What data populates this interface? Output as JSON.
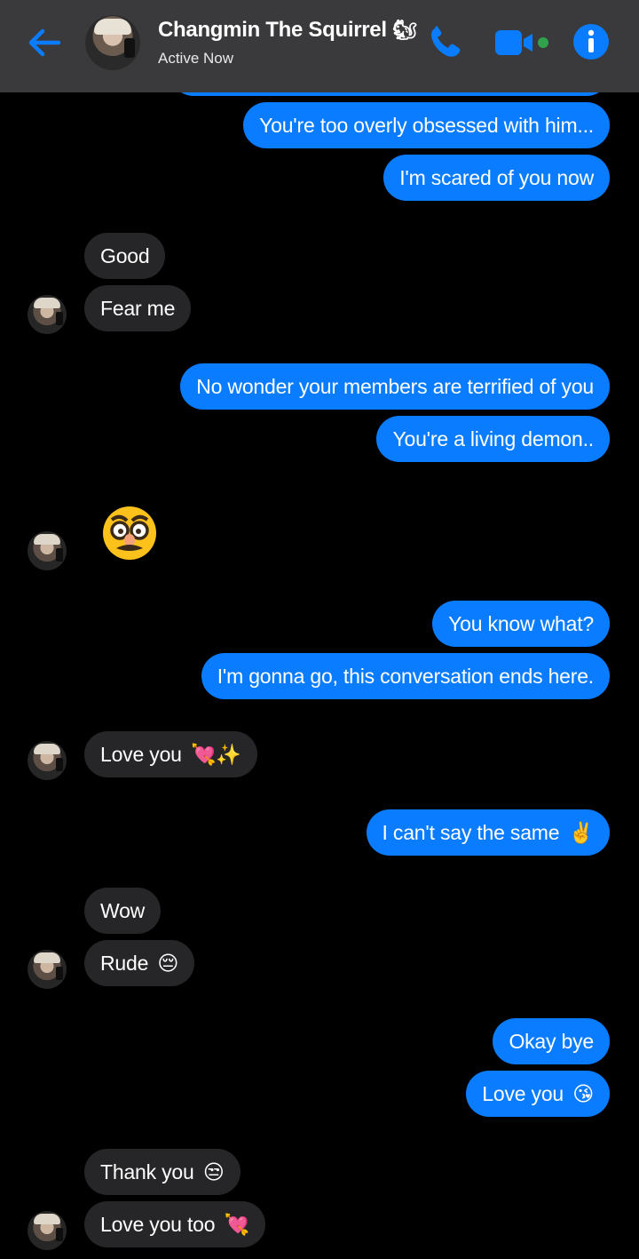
{
  "header": {
    "title": "Changmin The Squirrel",
    "title_emoji": "🐿",
    "status": "Active Now",
    "accent": "#0a7cff",
    "online_dot": "#31a24c"
  },
  "messages": {
    "m1": "You're too overly obsessed with him...",
    "m2": "I'm scared of you now",
    "m3": "Good",
    "m4": "Fear me",
    "m5": "No wonder your members are terrified of you",
    "m6": "You're a living demon..",
    "m7_emoji": "🥸",
    "m8": "You know what?",
    "m9": "I'm gonna go, this conversation ends here.",
    "m10": "Love you",
    "m10_emoji": "💘✨",
    "m11": "I can't say the same",
    "m11_emoji": "✌️",
    "m12": "Wow",
    "m13": "Rude",
    "m13_emoji": "😔",
    "m14": "Okay bye",
    "m15": "Love you",
    "m15_emoji": "😘",
    "m16": "Thank you",
    "m16_emoji": "😒",
    "m17": "Love you too",
    "m17_emoji": "💘"
  },
  "colors": {
    "outgoing_bubble": "#0a7cff",
    "incoming_bubble": "#262628",
    "background": "#000000",
    "header_bg": "#3a3a3c"
  },
  "icons": [
    "back-arrow-icon",
    "voice-call-icon",
    "video-call-icon",
    "info-icon"
  ]
}
